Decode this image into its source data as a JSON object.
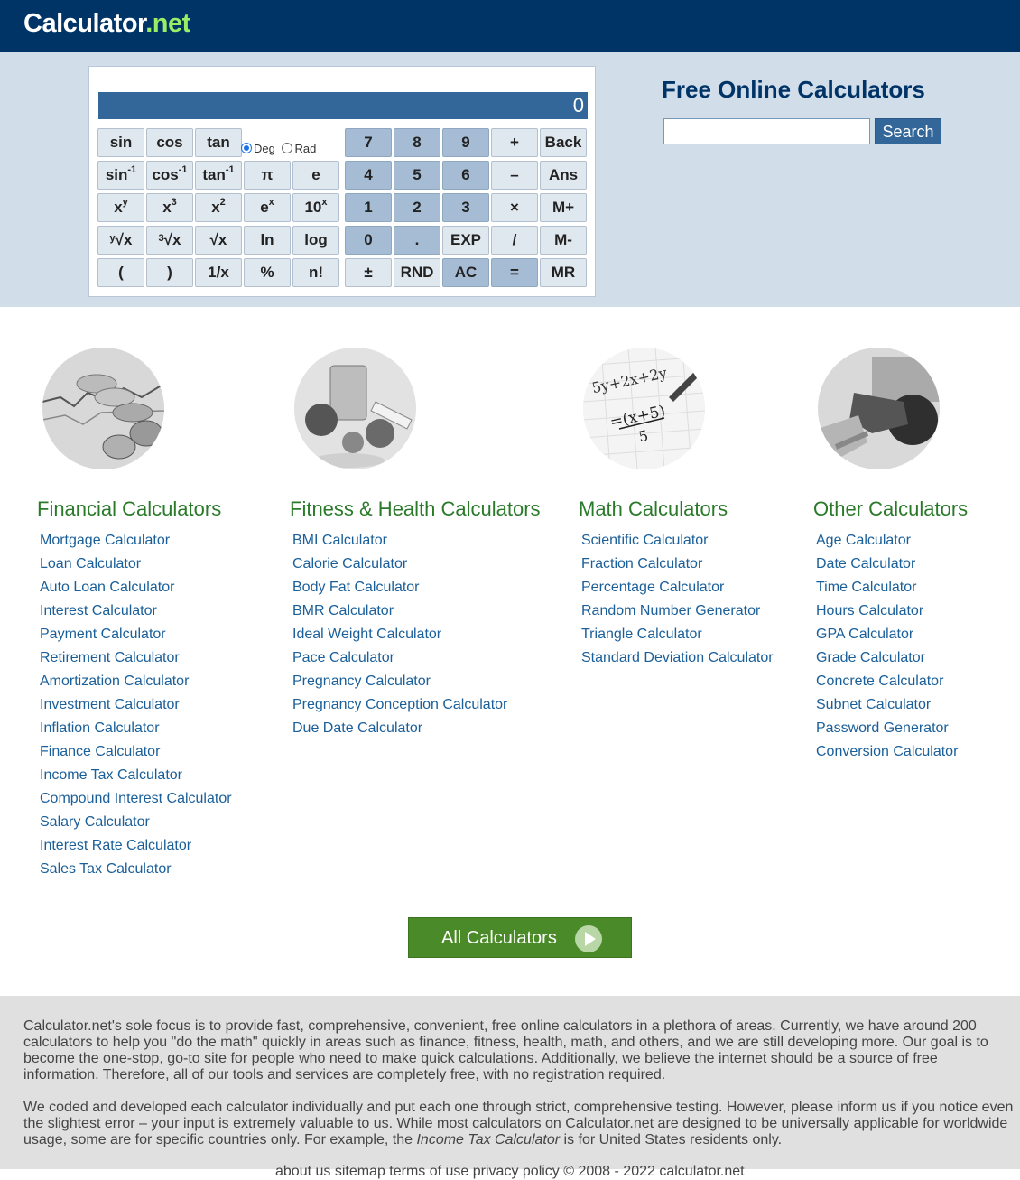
{
  "header": {
    "logo_main": "Calculator",
    "logo_suffix": ".net"
  },
  "calculator": {
    "display": "0",
    "deg_label": "Deg",
    "rad_label": "Rad",
    "deg_selected": true
  },
  "search": {
    "title": "Free Online Calculators",
    "placeholder": "",
    "value": "",
    "button_label": "Search"
  },
  "categories": [
    {
      "title": "Financial Calculators",
      "image": "coins-chart",
      "links": [
        "Mortgage Calculator",
        "Loan Calculator",
        "Auto Loan Calculator",
        "Interest Calculator",
        "Payment Calculator",
        "Retirement Calculator",
        "Amortization Calculator",
        "Investment Calculator",
        "Inflation Calculator",
        "Finance Calculator",
        "Income Tax Calculator",
        "Compound Interest Calculator",
        "Salary Calculator",
        "Interest Rate Calculator",
        "Sales Tax Calculator"
      ]
    },
    {
      "title": "Fitness & Health Calculators",
      "image": "food-tape",
      "links": [
        "BMI Calculator",
        "Calorie Calculator",
        "Body Fat Calculator",
        "BMR Calculator",
        "Ideal Weight Calculator",
        "Pace Calculator",
        "Pregnancy Calculator",
        "Pregnancy Conception Calculator",
        "Due Date Calculator"
      ]
    },
    {
      "title": "Math Calculators",
      "image": "math-paper",
      "links": [
        "Scientific Calculator",
        "Fraction Calculator",
        "Percentage Calculator",
        "Random Number Generator",
        "Triangle Calculator",
        "Standard Deviation Calculator"
      ]
    },
    {
      "title": "Other Calculators",
      "image": "fuel-pump",
      "links": [
        "Age Calculator",
        "Date Calculator",
        "Time Calculator",
        "Hours Calculator",
        "GPA Calculator",
        "Grade Calculator",
        "Concrete Calculator",
        "Subnet Calculator",
        "Password Generator",
        "Conversion Calculator"
      ]
    }
  ],
  "all_calculators_label": "All Calculators",
  "footer": {
    "p1": "Calculator.net's sole focus is to provide fast, comprehensive, convenient, free online calculators in a plethora of areas. Currently, we have around 200 calculators to help you \"do the math\" quickly in areas such as finance, fitness, health, math, and others, and we are still developing more. Our goal is to become the one-stop, go-to site for people who need to make quick calculations. Additionally, we believe the internet should be a source of free information. Therefore, all of our tools and services are completely free, with no registration required.",
    "p2_a": "We coded and developed each calculator individually and put each one through strict, comprehensive testing. However, please inform us if you notice even the slightest error – your input is extremely valuable to us. While most calculators on Calculator.net are designed to be universally applicable for worldwide usage, some are for specific countries only. For example, the ",
    "p2_em": "Income Tax Calculator",
    "p2_b": " is for United States residents only.",
    "p3": "about us   sitemap   terms of use   privacy policy   © 2008 - 2022 calculator.net"
  }
}
